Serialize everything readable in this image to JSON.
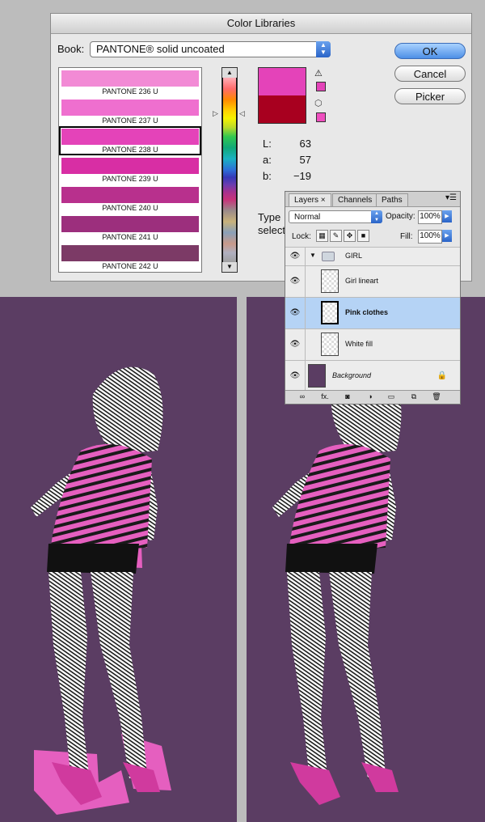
{
  "dialog": {
    "title": "Color Libraries",
    "book_label": "Book:",
    "book_value": "PANTONE® solid uncoated",
    "swatches": [
      {
        "name": "PANTONE 236 U",
        "color": "#f28ad5"
      },
      {
        "name": "PANTONE 237 U",
        "color": "#ef6fcf"
      },
      {
        "name": "PANTONE 238 U",
        "color": "#e443b9"
      },
      {
        "name": "PANTONE 239 U",
        "color": "#d82ea4"
      },
      {
        "name": "PANTONE 240 U",
        "color": "#b8308d"
      },
      {
        "name": "PANTONE 241 U",
        "color": "#9c2f7d"
      },
      {
        "name": "PANTONE 242 U",
        "color": "#7c3a66"
      }
    ],
    "selected_index": 2,
    "preview_new": "#e443b9",
    "preview_old": "#a8001f",
    "gamut_color": "#e443b9",
    "web_color": "#ef4fbf",
    "lab": [
      {
        "label": "L:",
        "value": "63"
      },
      {
        "label": "a:",
        "value": "57"
      },
      {
        "label": "b:",
        "value": "−19"
      }
    ],
    "type_text": "Type",
    "select_text": "select",
    "buttons": {
      "ok": "OK",
      "cancel": "Cancel",
      "picker": "Picker"
    }
  },
  "layers_panel": {
    "tabs": [
      "Layers",
      "Channels",
      "Paths"
    ],
    "blend_mode": "Normal",
    "opacity_label": "Opacity:",
    "opacity": "100%",
    "lock_label": "Lock:",
    "fill_label": "Fill:",
    "fill": "100%",
    "group_name": "GIRL",
    "layers": [
      {
        "name": "Girl lineart"
      },
      {
        "name": "Pink clothes"
      },
      {
        "name": "White fill"
      }
    ],
    "background_name": "Background",
    "footer_fx": "fx."
  },
  "colors": {
    "background_purple": "#5b3d63",
    "pink": "#e55fbf",
    "selection_blue": "#b5d3f5"
  }
}
